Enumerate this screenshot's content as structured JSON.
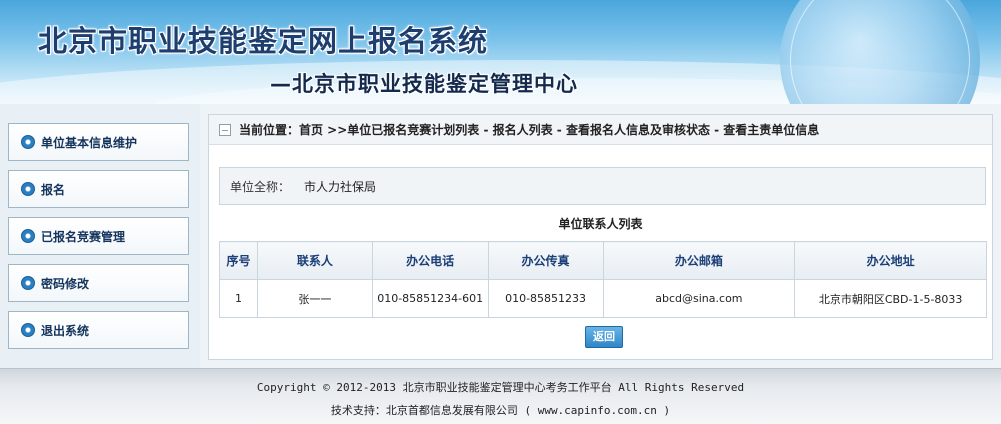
{
  "header": {
    "title": "北京市职业技能鉴定网上报名系统",
    "subtitle": "—北京市职业技能鉴定管理中心"
  },
  "sidebar": {
    "items": [
      {
        "label": "单位基本信息维护",
        "icon": "radio-bullet-icon"
      },
      {
        "label": "报名",
        "icon": "radio-bullet-icon"
      },
      {
        "label": "已报名竞赛管理",
        "icon": "radio-bullet-icon"
      },
      {
        "label": "密码修改",
        "icon": "radio-bullet-icon"
      },
      {
        "label": "退出系统",
        "icon": "radio-bullet-icon"
      }
    ]
  },
  "breadcrumb": {
    "text": "当前位置：首页 >>单位已报名竞赛计划列表 - 报名人列表 - 查看报名人信息及审核状态 - 查看主责单位信息"
  },
  "unit": {
    "label": "单位全称：",
    "value": "市人力社保局"
  },
  "contacts": {
    "title": "单位联系人列表",
    "headers": [
      "序号",
      "联系人",
      "办公电话",
      "办公传真",
      "办公邮箱",
      "办公地址"
    ],
    "rows": [
      [
        "1",
        "张一一",
        "010-85851234-601",
        "010-85851233",
        "abcd@sina.com",
        "北京市朝阳区CBD-1-5-8033"
      ]
    ]
  },
  "actions": {
    "back_label": "返回"
  },
  "footer": {
    "copyright": "Copyright © 2012-2013 北京市职业技能鉴定管理中心考务工作平台 All Rights Reserved",
    "support": "技术支持：北京首都信息发展有限公司 ( www.capinfo.com.cn )"
  },
  "colors": {
    "accent": "#2f86c7",
    "header_text": "#1d3e6e",
    "table_header_text": "#1b3f78"
  }
}
